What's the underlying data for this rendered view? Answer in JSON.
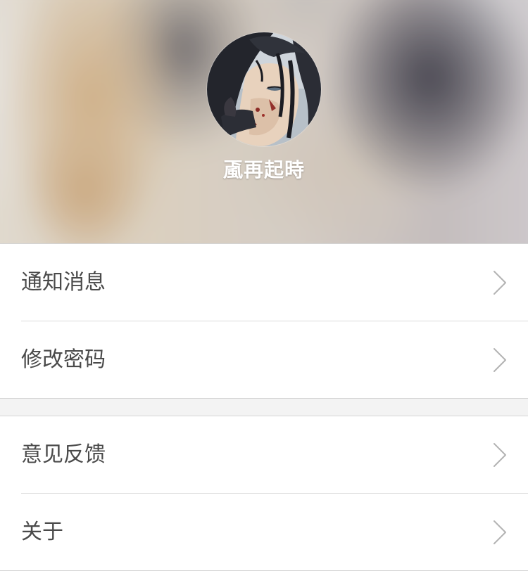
{
  "profile": {
    "username": "颪再起時"
  },
  "menu": {
    "group1": [
      {
        "label": "通知消息",
        "icon": "chevron-right-icon"
      },
      {
        "label": "修改密码",
        "icon": "chevron-right-icon"
      }
    ],
    "group2": [
      {
        "label": "意见反馈",
        "icon": "chevron-right-icon"
      },
      {
        "label": "关于",
        "icon": "chevron-right-icon"
      }
    ]
  },
  "colors": {
    "background": "#f3f3f3",
    "row_background": "#ffffff",
    "row_text": "#4a4a4a",
    "divider": "#dcdcdc",
    "chevron": "#b3b3b3",
    "username_text": "#ffffff"
  }
}
